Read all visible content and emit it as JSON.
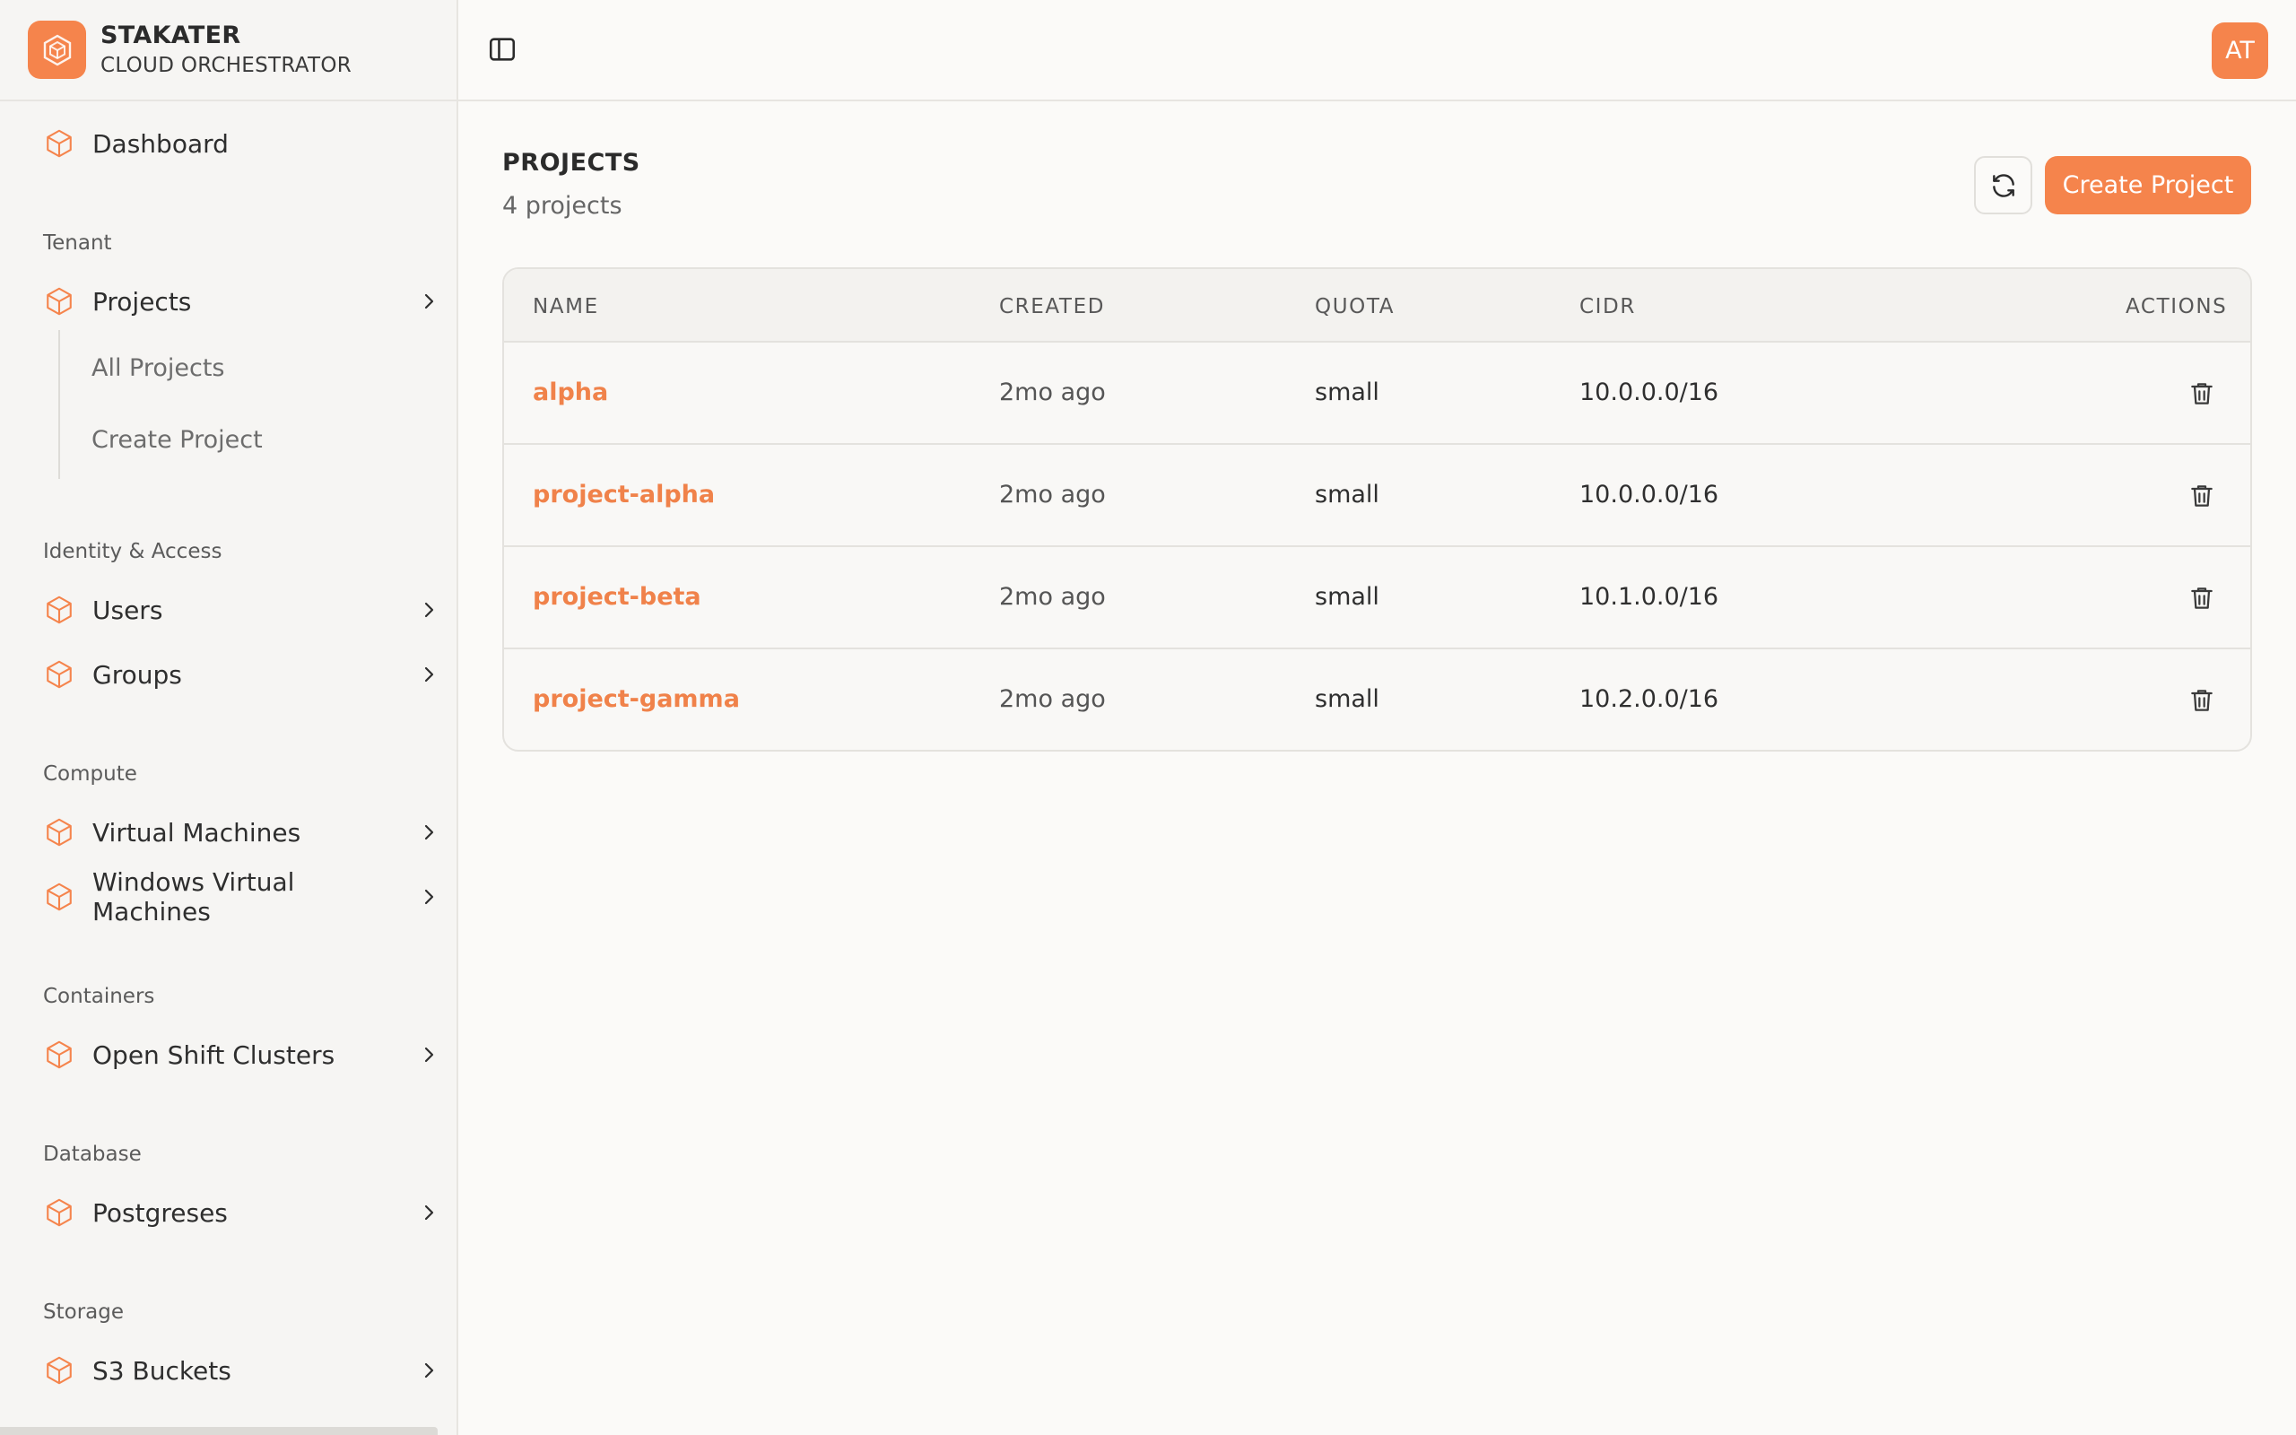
{
  "brand": {
    "name": "STAKATER",
    "subtitle": "CLOUD ORCHESTRATOR",
    "accent_color": "#f5844c"
  },
  "sidebar": {
    "dashboard": {
      "label": "Dashboard",
      "icon": "cube-icon"
    },
    "sections": {
      "tenant": "Tenant",
      "identity": "Identity & Access",
      "compute": "Compute",
      "containers": "Containers",
      "database": "Database",
      "storage": "Storage"
    },
    "items": {
      "projects": "Projects",
      "all_projects": "All Projects",
      "create_project": "Create Project",
      "users": "Users",
      "groups": "Groups",
      "virtual_machines": "Virtual Machines",
      "windows_vms": "Windows Virtual Machines",
      "openshift": "Open Shift Clusters",
      "postgreses": "Postgreses",
      "s3": "S3 Buckets"
    }
  },
  "topbar": {
    "toggle_icon": "sidebar-toggle-icon",
    "avatar_initials": "AT"
  },
  "page": {
    "title": "PROJECTS",
    "count": "4 projects",
    "refresh_icon": "refresh-icon",
    "create_label": "Create Project"
  },
  "table": {
    "headers": {
      "name": "NAME",
      "created": "CREATED",
      "quota": "QUOTA",
      "cidr": "CIDR",
      "actions": "ACTIONS"
    },
    "rows": [
      {
        "name": "alpha",
        "created": "2mo ago",
        "quota": "small",
        "cidr": "10.0.0.0/16"
      },
      {
        "name": "project-alpha",
        "created": "2mo ago",
        "quota": "small",
        "cidr": "10.0.0.0/16"
      },
      {
        "name": "project-beta",
        "created": "2mo ago",
        "quota": "small",
        "cidr": "10.1.0.0/16"
      },
      {
        "name": "project-gamma",
        "created": "2mo ago",
        "quota": "small",
        "cidr": "10.2.0.0/16"
      }
    ],
    "delete_icon": "trash-icon"
  }
}
